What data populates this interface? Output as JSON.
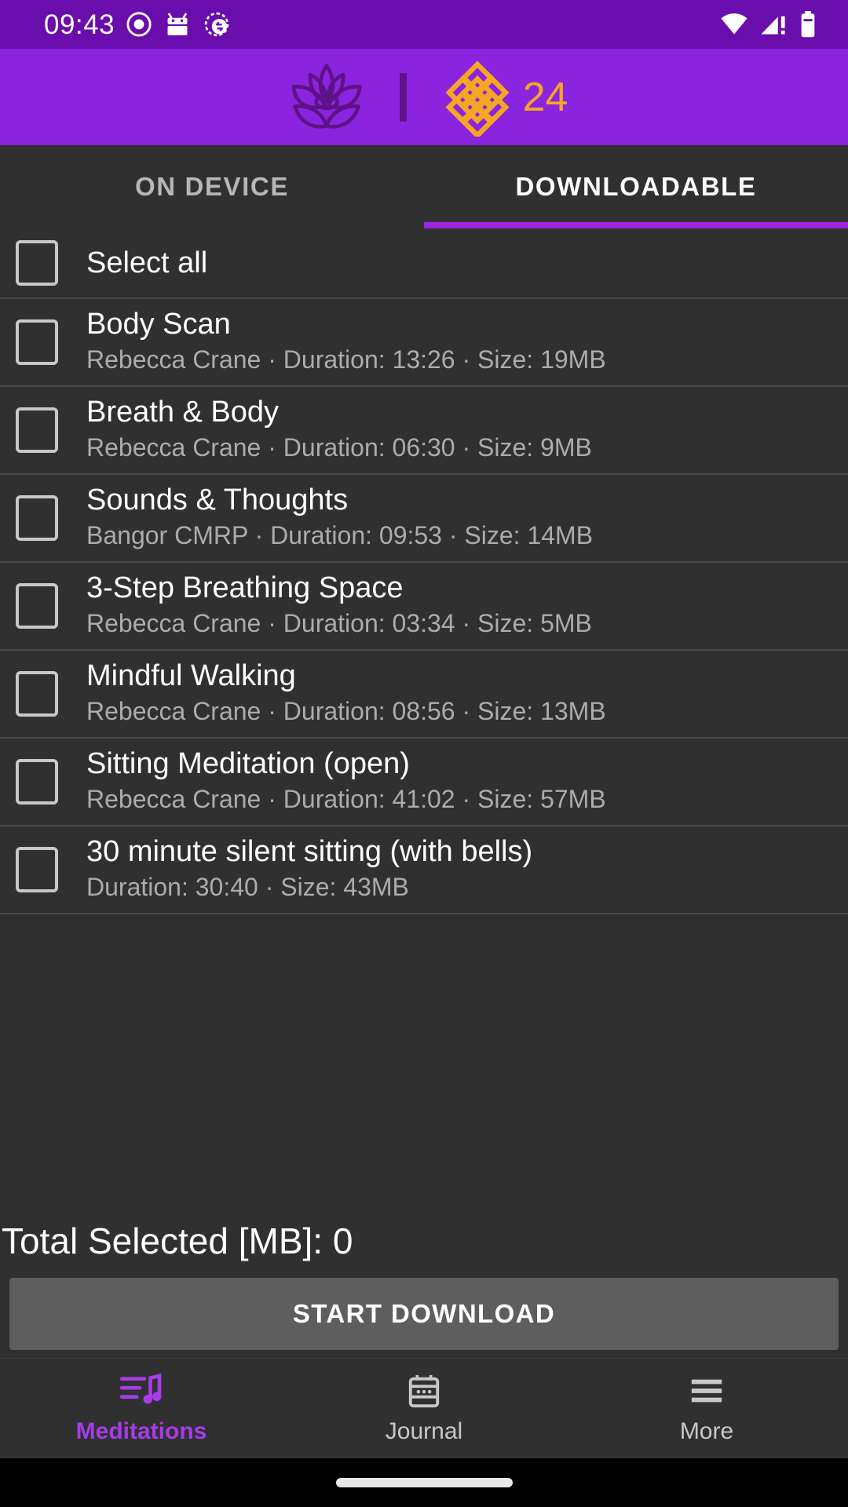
{
  "status_bar": {
    "time": "09:43",
    "icons_left": [
      "record-icon",
      "android-robot-icon",
      "signal-sync-icon"
    ],
    "icons_right": [
      "wifi-icon",
      "cellular-signal-alert-icon",
      "battery-icon"
    ],
    "background": "#6A0DAD"
  },
  "app_bar": {
    "logo_icon": "lotus-icon",
    "knot_icon": "endless-knot-icon",
    "count": "24",
    "background": "#8B24DE",
    "accent": "#F5A623"
  },
  "tabs": {
    "items": [
      {
        "label": "ON DEVICE",
        "active": false
      },
      {
        "label": "DOWNLOADABLE",
        "active": true
      }
    ],
    "indicator_color": "#9C27E0"
  },
  "select_all": {
    "label": "Select all",
    "checked": false
  },
  "meditations": [
    {
      "title": "Body Scan",
      "author": "Rebecca Crane",
      "duration": "13:26",
      "size": "19MB",
      "subtitle": "Rebecca Crane · Duration: 13:26 · Size: 19MB",
      "checked": false
    },
    {
      "title": "Breath & Body",
      "author": "Rebecca Crane",
      "duration": "06:30",
      "size": "9MB",
      "subtitle": "Rebecca Crane · Duration: 06:30 · Size: 9MB",
      "checked": false
    },
    {
      "title": "Sounds & Thoughts",
      "author": "Bangor CMRP",
      "duration": "09:53",
      "size": "14MB",
      "subtitle": "Bangor CMRP · Duration: 09:53 · Size: 14MB",
      "checked": false
    },
    {
      "title": "3-Step Breathing Space",
      "author": "Rebecca Crane",
      "duration": "03:34",
      "size": "5MB",
      "subtitle": "Rebecca Crane · Duration: 03:34 · Size: 5MB",
      "checked": false
    },
    {
      "title": "Mindful Walking",
      "author": "Rebecca Crane",
      "duration": "08:56",
      "size": "13MB",
      "subtitle": "Rebecca Crane · Duration: 08:56 · Size: 13MB",
      "checked": false
    },
    {
      "title": "Sitting Meditation (open)",
      "author": "Rebecca Crane",
      "duration": "41:02",
      "size": "57MB",
      "subtitle": "Rebecca Crane · Duration: 41:02 · Size: 57MB",
      "checked": false
    },
    {
      "title": "30 minute silent sitting (with bells)",
      "author": "",
      "duration": "30:40",
      "size": "43MB",
      "subtitle": "Duration: 30:40 · Size: 43MB",
      "checked": false
    }
  ],
  "footer": {
    "total_label": "Total Selected [MB]: 0",
    "download_button": "START DOWNLOAD"
  },
  "bottom_nav": {
    "items": [
      {
        "label": "Meditations",
        "icon": "playlist-music-icon",
        "active": true
      },
      {
        "label": "Journal",
        "icon": "calendar-icon",
        "active": false
      },
      {
        "label": "More",
        "icon": "hamburger-menu-icon",
        "active": false
      }
    ],
    "active_color": "#A63CEA",
    "idle_color": "#C8C8C8"
  }
}
